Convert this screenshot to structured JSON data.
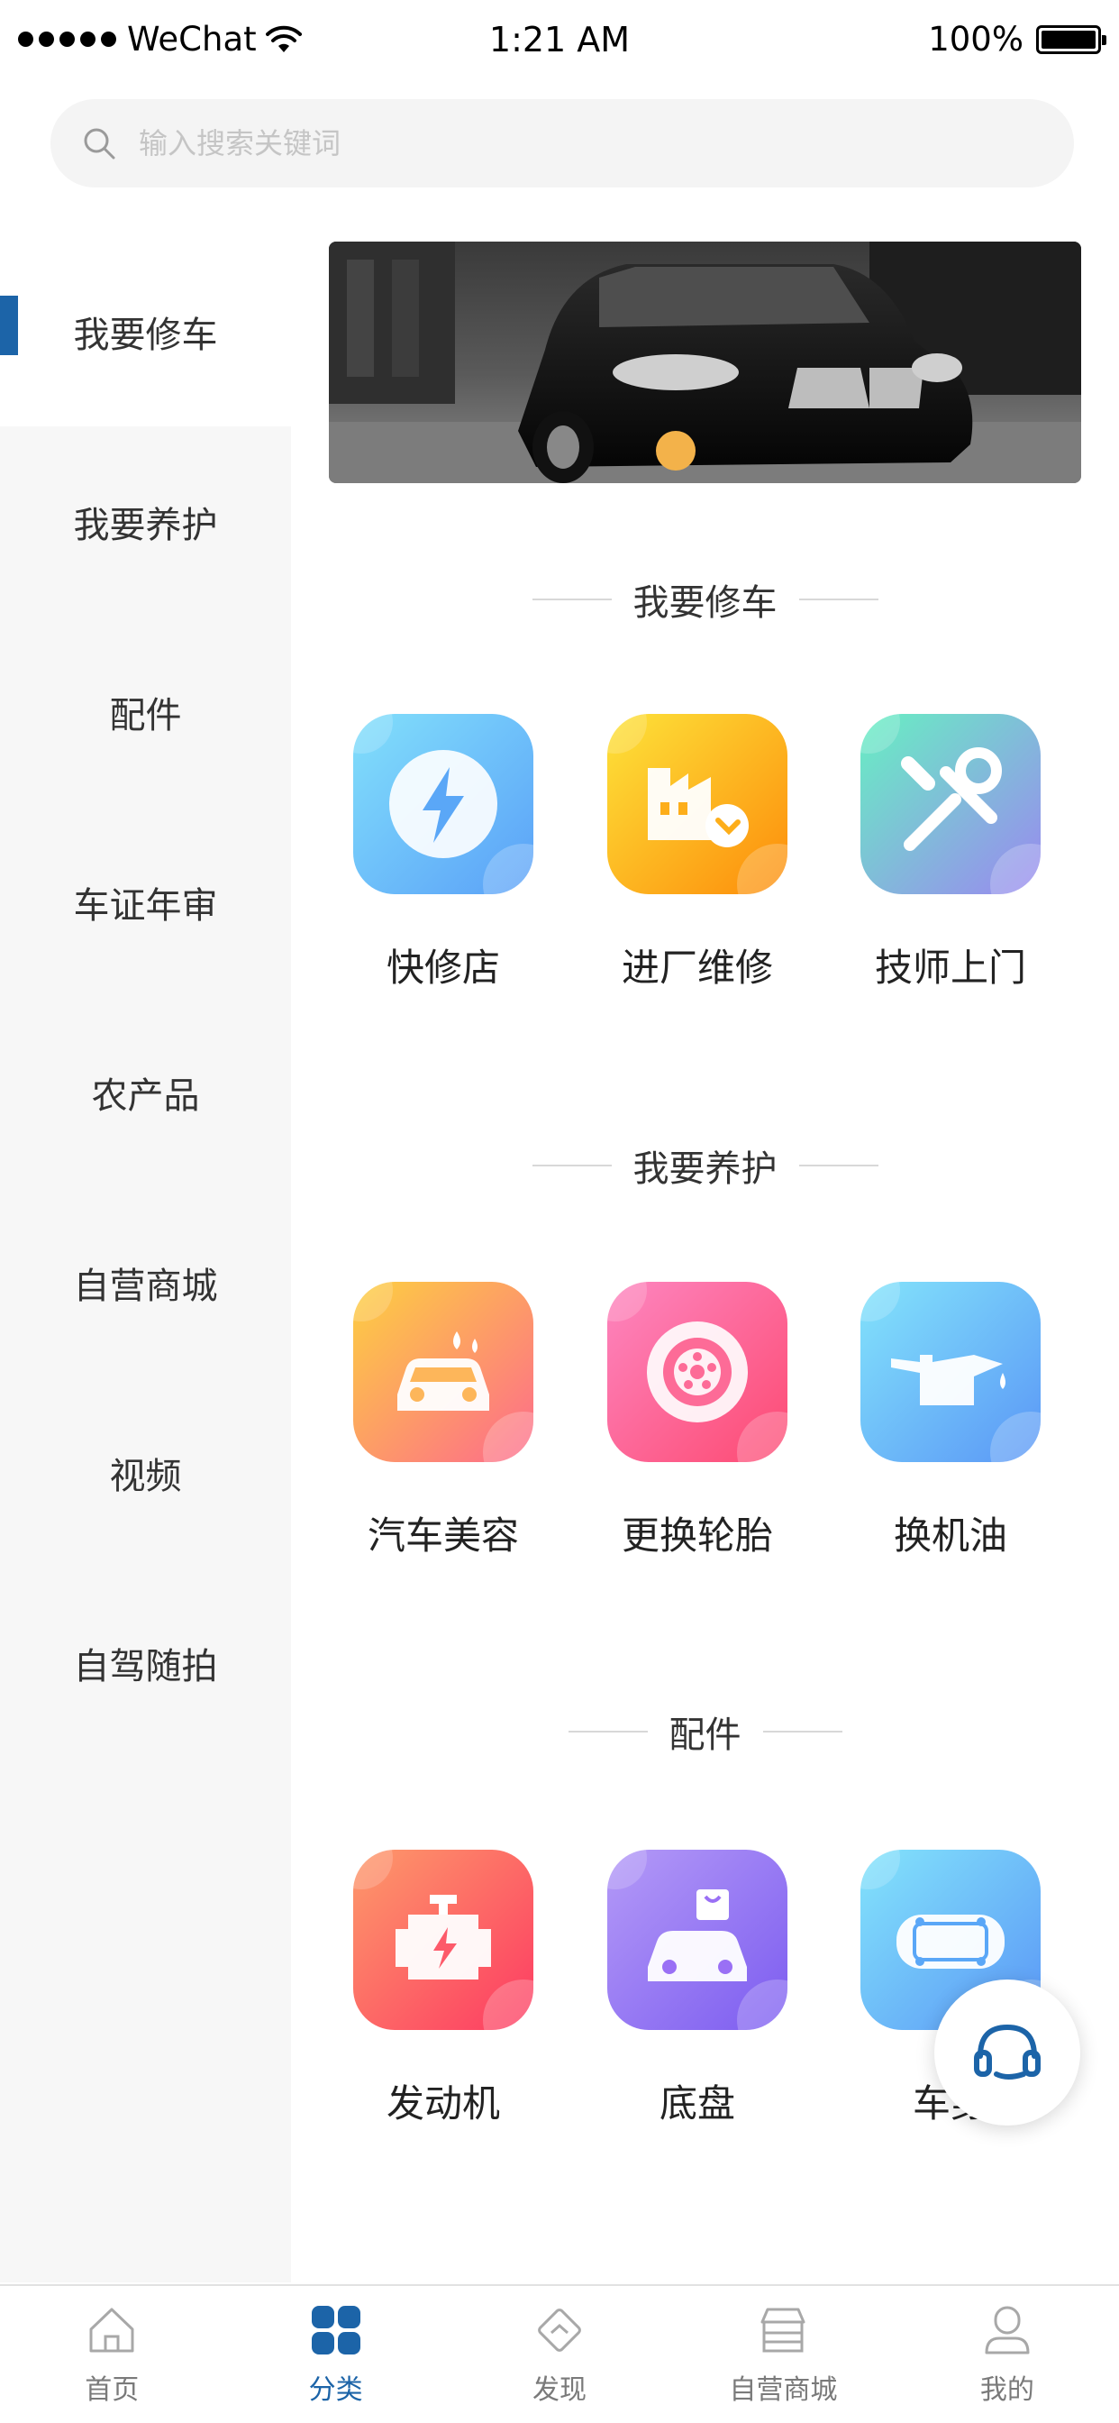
{
  "status_bar": {
    "carrier": "WeChat",
    "time": "1:21 AM",
    "battery": "100%"
  },
  "search": {
    "placeholder": "输入搜索关键词"
  },
  "sidebar": {
    "items": [
      {
        "label": "我要修车",
        "active": true
      },
      {
        "label": "我要养护"
      },
      {
        "label": "配件"
      },
      {
        "label": "车证年审"
      },
      {
        "label": "农产品"
      },
      {
        "label": "自营商城"
      },
      {
        "label": "视频"
      },
      {
        "label": "自驾随拍"
      }
    ]
  },
  "sections": [
    {
      "title": "我要修车",
      "items": [
        {
          "label": "快修店",
          "icon": "lightning-icon",
          "color": "#5aa7f7"
        },
        {
          "label": "进厂维修",
          "icon": "factory-icon",
          "color": "#fdae1a"
        },
        {
          "label": "技师上门",
          "icon": "tools-icon",
          "color": "#6bc9d9"
        }
      ]
    },
    {
      "title": "我要养护",
      "items": [
        {
          "label": "汽车美容",
          "icon": "car-wash-icon",
          "color": "#fd9a4a"
        },
        {
          "label": "更换轮胎",
          "icon": "tire-icon",
          "color": "#fd5c8c"
        },
        {
          "label": "换机油",
          "icon": "oil-can-icon",
          "color": "#5aa7f7"
        }
      ]
    },
    {
      "title": "配件",
      "items": [
        {
          "label": "发动机",
          "icon": "engine-icon",
          "color": "#fd4b6a"
        },
        {
          "label": "底盘",
          "icon": "chassis-icon",
          "color": "#9a70f5"
        },
        {
          "label": "车身",
          "icon": "car-body-icon",
          "color": "#5aa7f7"
        }
      ]
    }
  ],
  "tab_bar": {
    "tabs": [
      {
        "label": "首页",
        "icon": "home-icon"
      },
      {
        "label": "分类",
        "icon": "category-icon",
        "active": true
      },
      {
        "label": "发现",
        "icon": "discover-icon"
      },
      {
        "label": "自营商城",
        "icon": "store-icon"
      },
      {
        "label": "我的",
        "icon": "profile-icon"
      }
    ]
  },
  "colors": {
    "accent": "#1c64a8",
    "sidebar_bg": "#f7f7f7"
  }
}
